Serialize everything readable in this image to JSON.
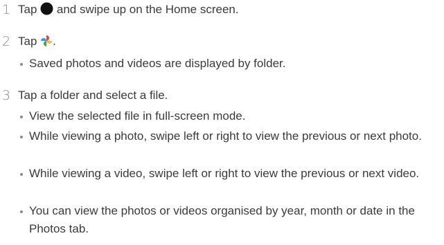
{
  "steps": [
    {
      "number": "1",
      "before_icon": "Tap",
      "icon": "home-button-circle-icon",
      "after_icon": "and swipe up on the Home screen."
    },
    {
      "number": "2",
      "before_icon": "Tap",
      "icon": "photos-pinwheel-icon",
      "after_icon": ".",
      "bullets": [
        "Saved photos and videos are displayed by folder."
      ]
    },
    {
      "number": "3",
      "text": "Tap a folder and select a file.",
      "bullets": [
        "View the selected file in full-screen mode.",
        "While viewing a photo, swipe left or right to view the previous or next photo.",
        "While viewing a video, swipe left or right to view the previous or next video.",
        "You can view the photos or videos organised by year, month or date in the Photos tab."
      ]
    }
  ],
  "colors": {
    "text": "#3a3a3a",
    "step_number": "#8a8a8a",
    "pinwheel_red": "#e8453c",
    "pinwheel_yellow": "#f9bb2d",
    "pinwheel_green": "#3aa757",
    "pinwheel_blue": "#4a8af4"
  }
}
